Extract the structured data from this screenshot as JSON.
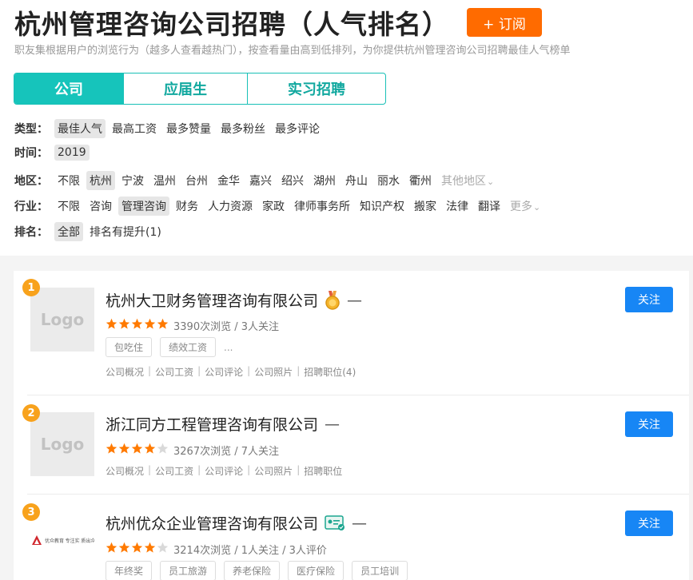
{
  "header": {
    "title": "杭州管理咨询公司招聘（人气排名）",
    "subscribe_label": "+ 订阅",
    "description": "职友集根据用户的浏览行为（越多人查看越热门），按查看量由高到低排列，为你提供杭州管理咨询公司招聘最佳人气榜单"
  },
  "tabs": [
    {
      "label": "公司",
      "active": true
    },
    {
      "label": "应届生",
      "active": false
    },
    {
      "label": "实习招聘",
      "active": false
    }
  ],
  "filters": {
    "type": {
      "label": "类型：",
      "options": [
        "最佳人气",
        "最高工资",
        "最多赞量",
        "最多粉丝",
        "最多评论"
      ],
      "selected": "最佳人气"
    },
    "time": {
      "label": "时间：",
      "options": [
        "2019"
      ],
      "selected": "2019"
    },
    "region": {
      "label": "地区：",
      "options": [
        "不限",
        "杭州",
        "宁波",
        "温州",
        "台州",
        "金华",
        "嘉兴",
        "绍兴",
        "湖州",
        "舟山",
        "丽水",
        "衢州"
      ],
      "more": "其他地区",
      "selected": "杭州"
    },
    "industry": {
      "label": "行业：",
      "options": [
        "不限",
        "咨询",
        "管理咨询",
        "财务",
        "人力资源",
        "家政",
        "律师事务所",
        "知识产权",
        "搬家",
        "法律",
        "翻译"
      ],
      "more": "更多",
      "selected": "管理咨询"
    },
    "rank": {
      "label": "排名：",
      "options": [
        "全部",
        "排名有提升(1)"
      ],
      "selected": "全部"
    }
  },
  "companies": [
    {
      "rank": "1",
      "logo_text": "Logo",
      "name": "杭州大卫财务管理咨询有限公司",
      "rating": 5,
      "stats": "3390次浏览 / 3人关注",
      "tags": [
        "包吃住",
        "绩效工资"
      ],
      "ellipsis": "...",
      "links": [
        "公司概况",
        "公司工资",
        "公司评论",
        "公司照片",
        "招聘职位(4)"
      ],
      "follow_label": "关注",
      "badge": "medal-icon"
    },
    {
      "rank": "2",
      "logo_text": "Logo",
      "name": "浙江同方工程管理咨询有限公司",
      "rating": 4,
      "stats": "3267次浏览 / 7人关注",
      "tags": [],
      "links": [
        "公司概况",
        "公司工资",
        "公司评论",
        "公司照片",
        "招聘职位"
      ],
      "follow_label": "关注"
    },
    {
      "rank": "3",
      "logo_text": "优众教育 专注实 质出众！",
      "name": "杭州优众企业管理咨询有限公司",
      "rating": 4,
      "stats": "3214次浏览 / 1人关注 / 3人评价",
      "tags": [
        "年终奖",
        "员工旅游",
        "养老保险",
        "医疗保险",
        "员工培训"
      ],
      "follow_label": "关注",
      "badge": "verified-license-icon"
    }
  ],
  "colors": {
    "accent_teal": "#16c4bb",
    "subscribe_orange": "#ff6b00",
    "rank_orange": "#f8a21c",
    "star_orange": "#ff7a00",
    "follow_blue": "#1786f5"
  }
}
